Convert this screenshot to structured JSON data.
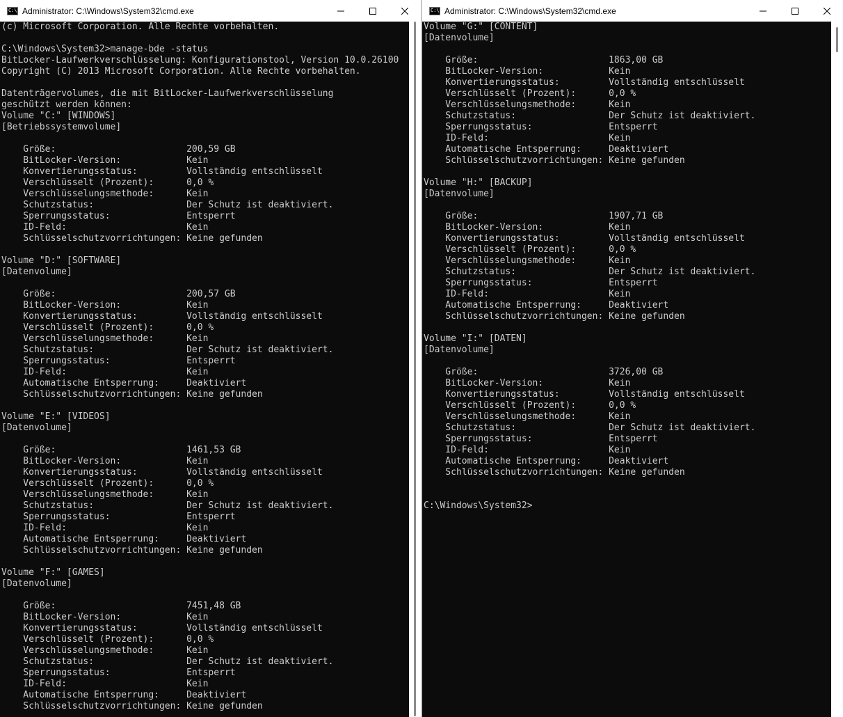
{
  "windows": [
    {
      "title": "Administrator: C:\\Windows\\System32\\cmd.exe",
      "icon_glyph": "C:\\",
      "output": "(c) Microsoft Corporation. Alle Rechte vorbehalten.\n\nC:\\Windows\\System32>manage-bde -status\nBitLocker-Laufwerkverschlüsselung: Konfigurationstool, Version 10.0.26100\nCopyright (C) 2013 Microsoft Corporation. Alle Rechte vorbehalten.\n\nDatenträgervolumes, die mit BitLocker-Laufwerkverschlüsselung\ngeschützt werden können:\nVolume \"C:\" [WINDOWS]\n[Betriebssystemvolume]\n\n    Größe:                        200,59 GB\n    BitLocker-Version:            Kein\n    Konvertierungsstatus:         Vollständig entschlüsselt\n    Verschlüsselt (Prozent):      0,0 %\n    Verschlüsselungsmethode:      Kein\n    Schutzstatus:                 Der Schutz ist deaktiviert.\n    Sperrungsstatus:              Entsperrt\n    ID-Feld:                      Kein\n    Schlüsselschutzvorrichtungen: Keine gefunden\n\nVolume \"D:\" [SOFTWARE]\n[Datenvolume]\n\n    Größe:                        200,57 GB\n    BitLocker-Version:            Kein\n    Konvertierungsstatus:         Vollständig entschlüsselt\n    Verschlüsselt (Prozent):      0,0 %\n    Verschlüsselungsmethode:      Kein\n    Schutzstatus:                 Der Schutz ist deaktiviert.\n    Sperrungsstatus:              Entsperrt\n    ID-Feld:                      Kein\n    Automatische Entsperrung:     Deaktiviert\n    Schlüsselschutzvorrichtungen: Keine gefunden\n\nVolume \"E:\" [VIDEOS]\n[Datenvolume]\n\n    Größe:                        1461,53 GB\n    BitLocker-Version:            Kein\n    Konvertierungsstatus:         Vollständig entschlüsselt\n    Verschlüsselt (Prozent):      0,0 %\n    Verschlüsselungsmethode:      Kein\n    Schutzstatus:                 Der Schutz ist deaktiviert.\n    Sperrungsstatus:              Entsperrt\n    ID-Feld:                      Kein\n    Automatische Entsperrung:     Deaktiviert\n    Schlüsselschutzvorrichtungen: Keine gefunden\n\nVolume \"F:\" [GAMES]\n[Datenvolume]\n\n    Größe:                        7451,48 GB\n    BitLocker-Version:            Kein\n    Konvertierungsstatus:         Vollständig entschlüsselt\n    Verschlüsselt (Prozent):      0,0 %\n    Verschlüsselungsmethode:      Kein\n    Schutzstatus:                 Der Schutz ist deaktiviert.\n    Sperrungsstatus:              Entsperrt\n    ID-Feld:                      Kein\n    Automatische Entsperrung:     Deaktiviert\n    Schlüsselschutzvorrichtungen: Keine gefunden"
    },
    {
      "title": "Administrator: C:\\Windows\\System32\\cmd.exe",
      "icon_glyph": "C:\\",
      "output": "Volume \"G:\" [CONTENT]\n[Datenvolume]\n\n    Größe:                        1863,00 GB\n    BitLocker-Version:            Kein\n    Konvertierungsstatus:         Vollständig entschlüsselt\n    Verschlüsselt (Prozent):      0,0 %\n    Verschlüsselungsmethode:      Kein\n    Schutzstatus:                 Der Schutz ist deaktiviert.\n    Sperrungsstatus:              Entsperrt\n    ID-Feld:                      Kein\n    Automatische Entsperrung:     Deaktiviert\n    Schlüsselschutzvorrichtungen: Keine gefunden\n\nVolume \"H:\" [BACKUP]\n[Datenvolume]\n\n    Größe:                        1907,71 GB\n    BitLocker-Version:            Kein\n    Konvertierungsstatus:         Vollständig entschlüsselt\n    Verschlüsselt (Prozent):      0,0 %\n    Verschlüsselungsmethode:      Kein\n    Schutzstatus:                 Der Schutz ist deaktiviert.\n    Sperrungsstatus:              Entsperrt\n    ID-Feld:                      Kein\n    Automatische Entsperrung:     Deaktiviert\n    Schlüsselschutzvorrichtungen: Keine gefunden\n\nVolume \"I:\" [DATEN]\n[Datenvolume]\n\n    Größe:                        3726,00 GB\n    BitLocker-Version:            Kein\n    Konvertierungsstatus:         Vollständig entschlüsselt\n    Verschlüsselt (Prozent):      0,0 %\n    Verschlüsselungsmethode:      Kein\n    Schutzstatus:                 Der Schutz ist deaktiviert.\n    Sperrungsstatus:              Entsperrt\n    ID-Feld:                      Kein\n    Automatische Entsperrung:     Deaktiviert\n    Schlüsselschutzvorrichtungen: Keine gefunden\n\n\nC:\\Windows\\System32>"
    }
  ],
  "icons": {
    "app": "cmd-icon",
    "minimize": "minimize-icon",
    "maximize": "maximize-icon",
    "close": "close-icon"
  },
  "colors": {
    "console_background": "#0c0c0c",
    "console_foreground": "#cccccc",
    "titlebar_background": "#ffffff"
  }
}
